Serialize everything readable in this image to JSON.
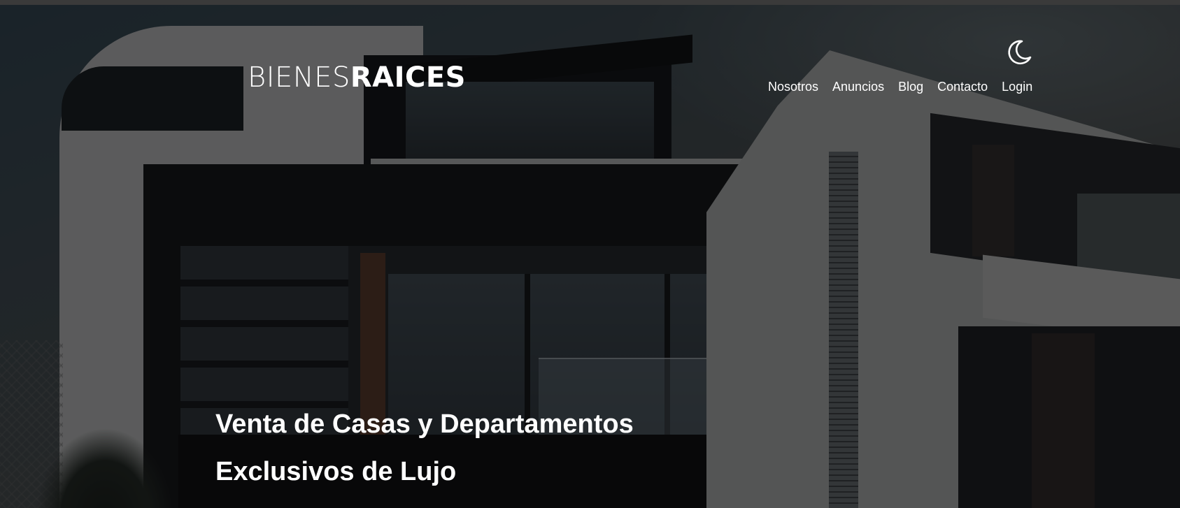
{
  "header": {
    "logo": {
      "light": "BIENES",
      "bold": "RAICES"
    },
    "dark_mode_icon": "moon-icon",
    "nav": [
      {
        "label": "Nosotros"
      },
      {
        "label": "Anuncios"
      },
      {
        "label": "Blog"
      },
      {
        "label": "Contacto"
      },
      {
        "label": "Login"
      }
    ]
  },
  "hero": {
    "title_line1": "Venta de Casas y Departamentos",
    "title_line2": "Exclusivos de Lujo"
  },
  "colors": {
    "overlay": "rgba(0,0,0,0.58)",
    "text": "#ffffff"
  }
}
